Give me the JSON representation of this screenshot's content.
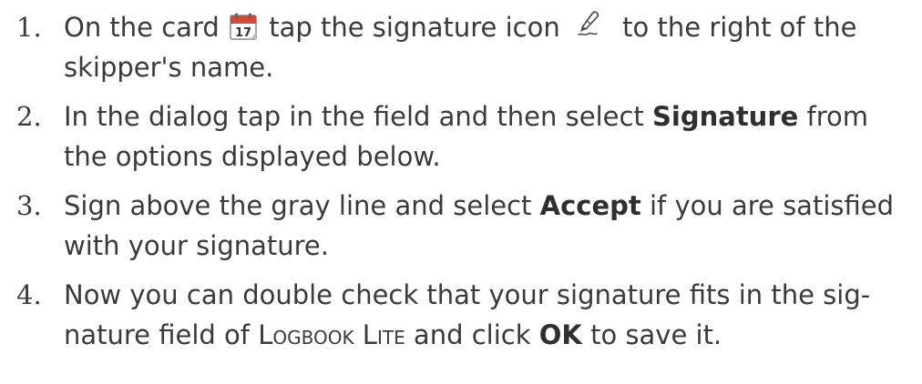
{
  "steps": [
    {
      "number": "1.",
      "t1": "On the card ",
      "t2": " tap the signature icon ",
      "t3": " to the right of the skipper's name."
    },
    {
      "number": "2.",
      "t1": "In the dialog tap in the field and then select ",
      "bold": "Signature",
      "t2": " from the options displayed below."
    },
    {
      "number": "3.",
      "t1": "Sign above the gray line and select ",
      "bold": "Accept",
      "t2": " if you are satisfied with your signature."
    },
    {
      "number": "4.",
      "t1": "Now you can double check that your signature fits in the sig-nature field of ",
      "app_name": "Logbook Lite",
      "t2": " and click ",
      "bold": "OK",
      "t3": " to save it."
    }
  ],
  "icons": {
    "calendar": {
      "name": "calendar-icon",
      "day": "17",
      "accent": "#d24a3a"
    },
    "signature": {
      "name": "fountain-pen-icon"
    }
  }
}
